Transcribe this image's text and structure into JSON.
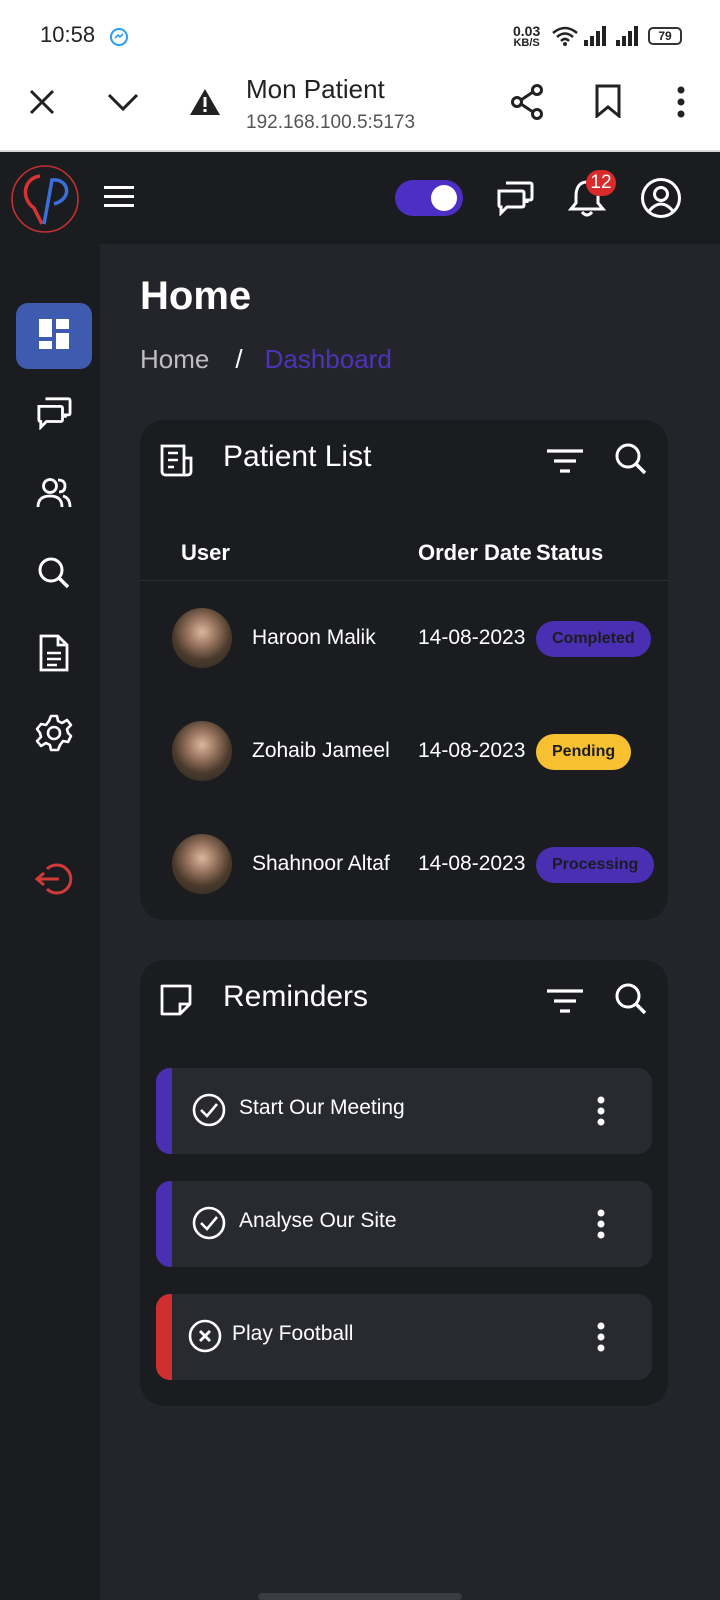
{
  "status_bar": {
    "time": "10:58",
    "net_speed_value": "0.03",
    "net_speed_unit": "KB/S",
    "battery": "79"
  },
  "browser": {
    "title": "Mon Patient",
    "url": "192.168.100.5:5173"
  },
  "topbar": {
    "notification_count": "12",
    "theme_toggle_on": true
  },
  "sidebar": {
    "items": [
      {
        "icon": "dashboard-icon",
        "active": true
      },
      {
        "icon": "chat-icon",
        "active": false
      },
      {
        "icon": "users-icon",
        "active": false
      },
      {
        "icon": "search-icon",
        "active": false
      },
      {
        "icon": "document-icon",
        "active": false
      },
      {
        "icon": "settings-icon",
        "active": false
      },
      {
        "icon": "logout-icon",
        "active": false
      }
    ]
  },
  "page": {
    "title": "Home",
    "breadcrumb": {
      "root": "Home",
      "separator": "/",
      "current": "Dashboard"
    }
  },
  "patient_list": {
    "title": "Patient List",
    "columns": {
      "user": "User",
      "order_date": "Order Date",
      "status": "Status"
    },
    "rows": [
      {
        "name": "Haroon Malik",
        "date": "14-08-2023",
        "status": "Completed"
      },
      {
        "name": "Zohaib Jameel",
        "date": "14-08-2023",
        "status": "Pending"
      },
      {
        "name": "Shahnoor Altaf",
        "date": "14-08-2023",
        "status": "Processing"
      }
    ]
  },
  "reminders": {
    "title": "Reminders",
    "items": [
      {
        "text": "Start Our Meeting",
        "state": "done"
      },
      {
        "text": "Analyse Our Site",
        "state": "done"
      },
      {
        "text": "Play Football",
        "state": "cancelled"
      }
    ]
  },
  "colors": {
    "accent": "#4d2fc5",
    "completed_badge": "#4a2fb3",
    "pending_badge": "#f6c031",
    "processing_badge": "#4a2fb3",
    "cancelled_bar": "#d12f2f",
    "logout_icon": "#d23a3a"
  }
}
